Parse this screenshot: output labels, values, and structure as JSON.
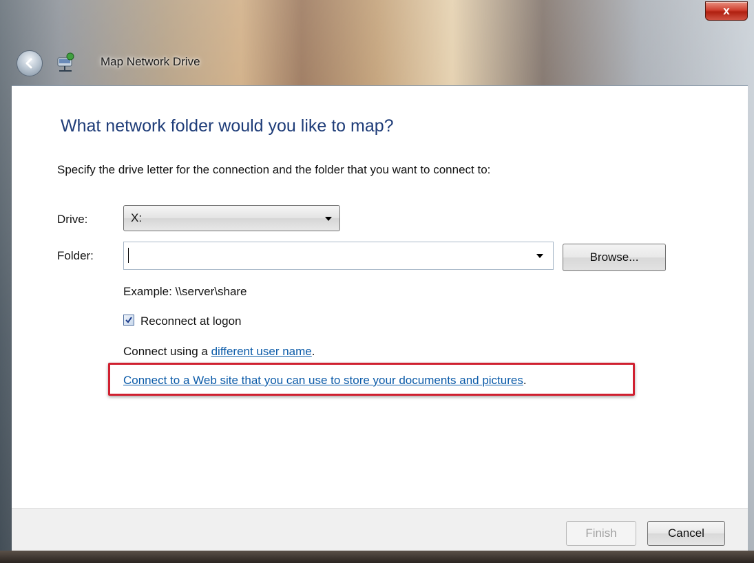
{
  "window": {
    "title": "Map Network Drive",
    "close_label": "x"
  },
  "dialog": {
    "heading": "What network folder would you like to map?",
    "instruction": "Specify the drive letter for the connection and the folder that you want to connect to:",
    "drive": {
      "label": "Drive:",
      "value": "X:"
    },
    "folder": {
      "label": "Folder:",
      "value": ""
    },
    "browse_label": "Browse...",
    "example": "Example: \\\\server\\share",
    "reconnect": {
      "label": "Reconnect at logon",
      "checked": true
    },
    "connect_using": {
      "prefix": "Connect using a ",
      "link": "different user name",
      "suffix": "."
    },
    "web_site": {
      "link": "Connect to a Web site that you can use to store your documents and pictures",
      "suffix": "."
    }
  },
  "footer": {
    "finish_label": "Finish",
    "cancel_label": "Cancel"
  },
  "colors": {
    "heading": "#1e3c78",
    "link": "#0a5aa8",
    "highlight": "#d02030",
    "close_button": "#d04030"
  },
  "icons": {
    "back": "back-arrow-icon",
    "network": "network-drive-icon",
    "dropdown": "chevron-down-icon",
    "check": "checkmark-icon"
  }
}
